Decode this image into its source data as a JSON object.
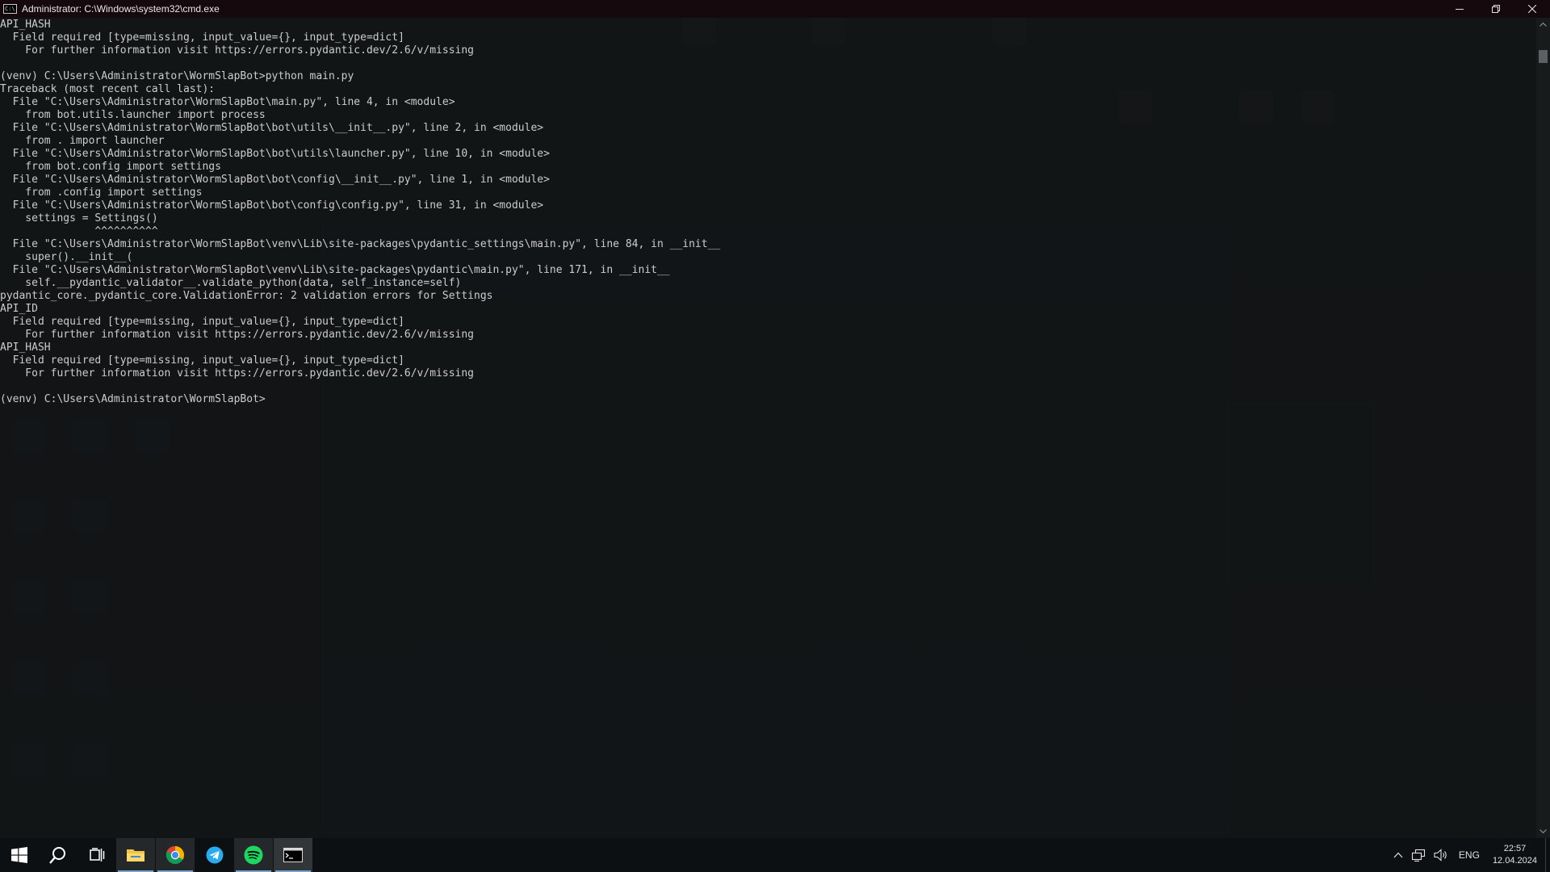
{
  "window": {
    "title": "Administrator: C:\\Windows\\system32\\cmd.exe",
    "icon_glyph": "C:\\"
  },
  "console": {
    "lines": [
      "API_HASH",
      "  Field required [type=missing, input_value={}, input_type=dict]",
      "    For further information visit https://errors.pydantic.dev/2.6/v/missing",
      "",
      "(venv) C:\\Users\\Administrator\\WormSlapBot>python main.py",
      "Traceback (most recent call last):",
      "  File \"C:\\Users\\Administrator\\WormSlapBot\\main.py\", line 4, in <module>",
      "    from bot.utils.launcher import process",
      "  File \"C:\\Users\\Administrator\\WormSlapBot\\bot\\utils\\__init__.py\", line 2, in <module>",
      "    from . import launcher",
      "  File \"C:\\Users\\Administrator\\WormSlapBot\\bot\\utils\\launcher.py\", line 10, in <module>",
      "    from bot.config import settings",
      "  File \"C:\\Users\\Administrator\\WormSlapBot\\bot\\config\\__init__.py\", line 1, in <module>",
      "    from .config import settings",
      "  File \"C:\\Users\\Administrator\\WormSlapBot\\bot\\config\\config.py\", line 31, in <module>",
      "    settings = Settings()",
      "               ^^^^^^^^^^",
      "  File \"C:\\Users\\Administrator\\WormSlapBot\\venv\\Lib\\site-packages\\pydantic_settings\\main.py\", line 84, in __init__",
      "    super().__init__(",
      "  File \"C:\\Users\\Administrator\\WormSlapBot\\venv\\Lib\\site-packages\\pydantic\\main.py\", line 171, in __init__",
      "    self.__pydantic_validator__.validate_python(data, self_instance=self)",
      "pydantic_core._pydantic_core.ValidationError: 2 validation errors for Settings",
      "API_ID",
      "  Field required [type=missing, input_value={}, input_type=dict]",
      "    For further information visit https://errors.pydantic.dev/2.6/v/missing",
      "API_HASH",
      "  Field required [type=missing, input_value={}, input_type=dict]",
      "    For further information visit https://errors.pydantic.dev/2.6/v/missing",
      "",
      "(venv) C:\\Users\\Administrator\\WormSlapBot>"
    ]
  },
  "taskbar": {
    "apps": [
      {
        "name": "start-button",
        "icon": "windows-logo-icon"
      },
      {
        "name": "search-button",
        "icon": "search-icon"
      },
      {
        "name": "task-view-button",
        "icon": "task-view-icon"
      },
      {
        "name": "file-explorer",
        "icon": "folder-icon"
      },
      {
        "name": "chrome",
        "icon": "chrome-icon"
      },
      {
        "name": "telegram",
        "icon": "telegram-icon"
      },
      {
        "name": "spotify",
        "icon": "spotify-icon"
      },
      {
        "name": "cmd",
        "icon": "terminal-icon"
      }
    ],
    "tray": {
      "language": "ENG",
      "time": "22:57",
      "date": "12.04.2024"
    }
  },
  "colors": {
    "console_text": "#cccccc",
    "titlebar": "#16090d",
    "taskbar": "#0d1012",
    "spotify_green": "#1ed760",
    "telegram_blue": "#2aabee",
    "explorer_yellow": "#f5c445"
  }
}
